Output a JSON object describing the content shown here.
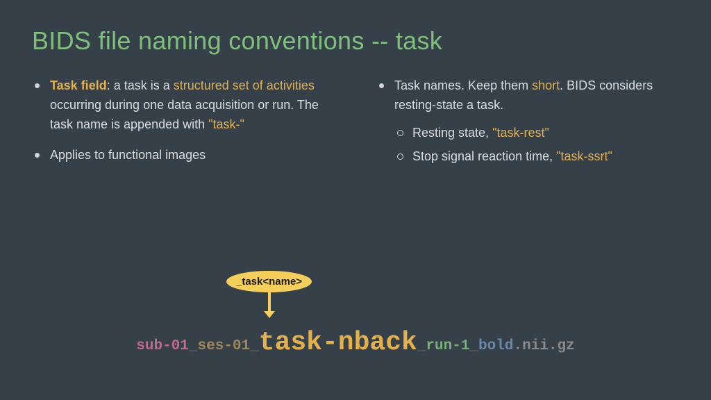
{
  "title": "BIDS file naming conventions -- task",
  "left": {
    "b1_label": "Task field",
    "b1_a": ": a task is a ",
    "b1_hl": "structured set of activities",
    "b1_b": " occurring during one data acquisition or run. The task name is appended with ",
    "b1_tag": "\"task-\"",
    "b2": "Applies to functional images"
  },
  "right": {
    "b1_a": "Task names. Keep them ",
    "b1_hl": "short",
    "b1_b": ". BIDS considers resting-state a task.",
    "s1_a": "Resting state, ",
    "s1_tag": "\"task-rest\"",
    "s2_a": "Stop signal reaction time, ",
    "s2_tag": "\"task-ssrt\""
  },
  "callout": "_task<name>",
  "filename": {
    "sub": "sub-01",
    "ses": "ses-01",
    "task": "task-nback",
    "run": "run-1",
    "bold": "bold",
    "ext": ".nii.gz",
    "us": "_"
  }
}
